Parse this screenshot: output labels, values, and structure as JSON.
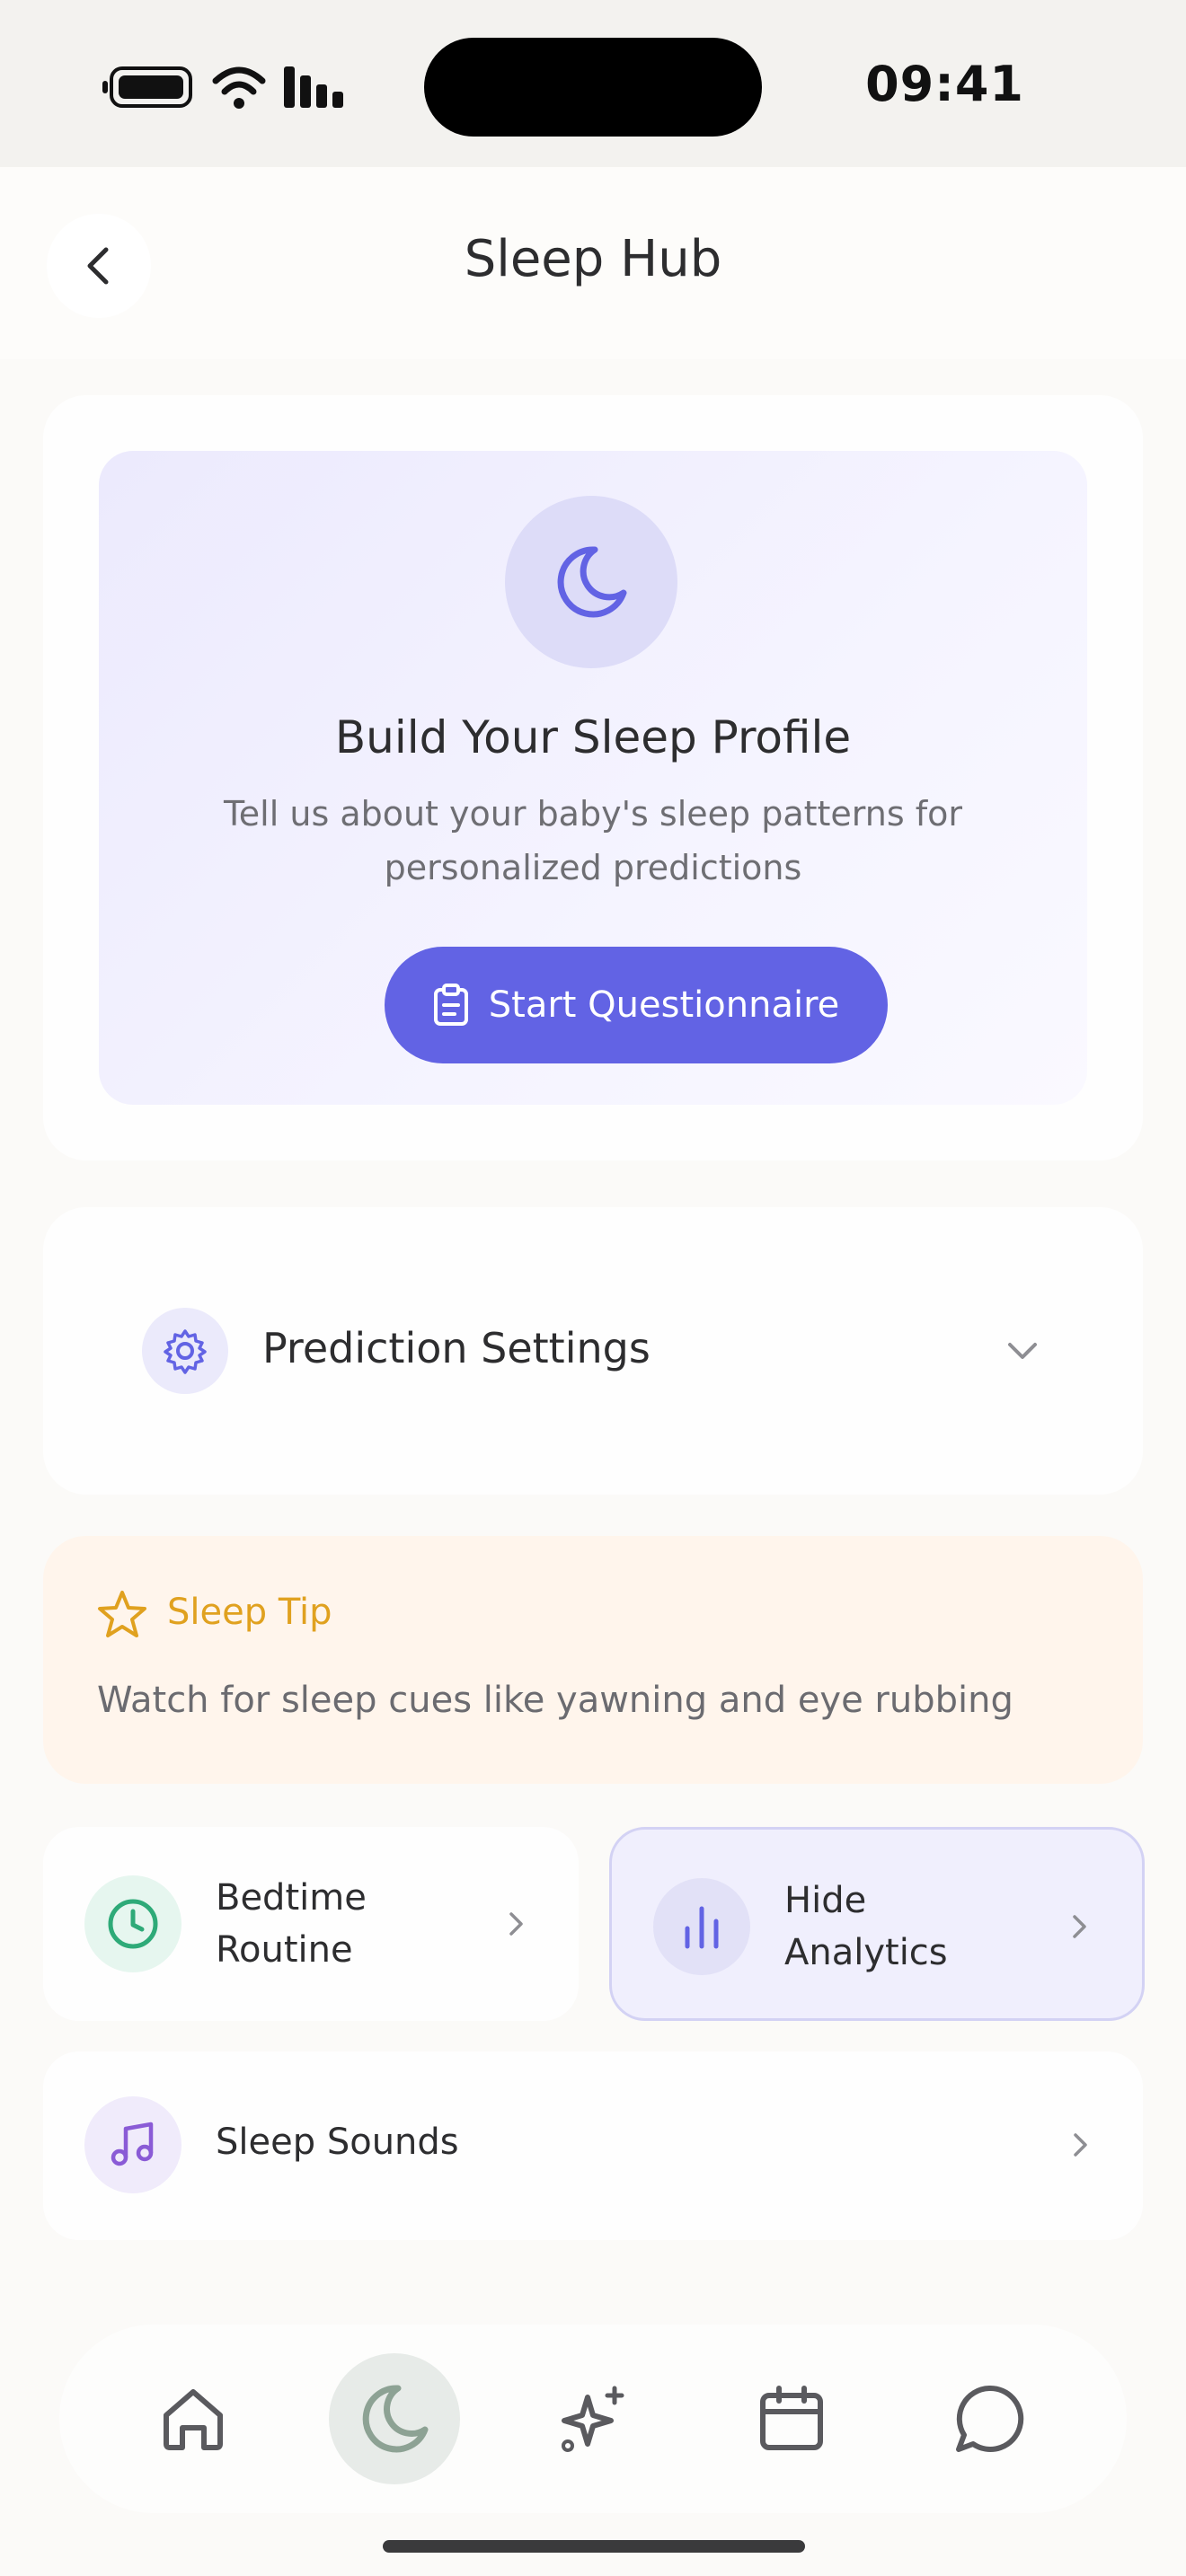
{
  "status_bar": {
    "time": "09:41"
  },
  "header": {
    "title": "Sleep Hub"
  },
  "profile": {
    "title": "Build Your Sleep Profile",
    "description": "Tell us about your baby's sleep patterns for personalized predictions",
    "button_label": "Start Questionnaire"
  },
  "settings": {
    "label": "Prediction Settings"
  },
  "tip": {
    "title": "Sleep Tip",
    "text": "Watch for sleep cues like yawning and eye rubbing"
  },
  "cards": {
    "bedtime": {
      "label_line1": "Bedtime",
      "label_line2": "Routine"
    },
    "analytics": {
      "label_line1": "Hide",
      "label_line2": "Analytics"
    },
    "sounds": {
      "label": "Sleep Sounds"
    }
  },
  "tab_bar": {
    "tabs": [
      {
        "icon": "home-icon",
        "active": false
      },
      {
        "icon": "moon-icon",
        "active": true
      },
      {
        "icon": "sparkle-icon",
        "active": false
      },
      {
        "icon": "calendar-icon",
        "active": false
      },
      {
        "icon": "chat-icon",
        "active": false
      }
    ]
  },
  "colors": {
    "accent": "#6263e4",
    "tip": "#e0a11f",
    "clock": "#2eaa78",
    "music": "#8a5bd6",
    "tab_active": "#8da294"
  }
}
